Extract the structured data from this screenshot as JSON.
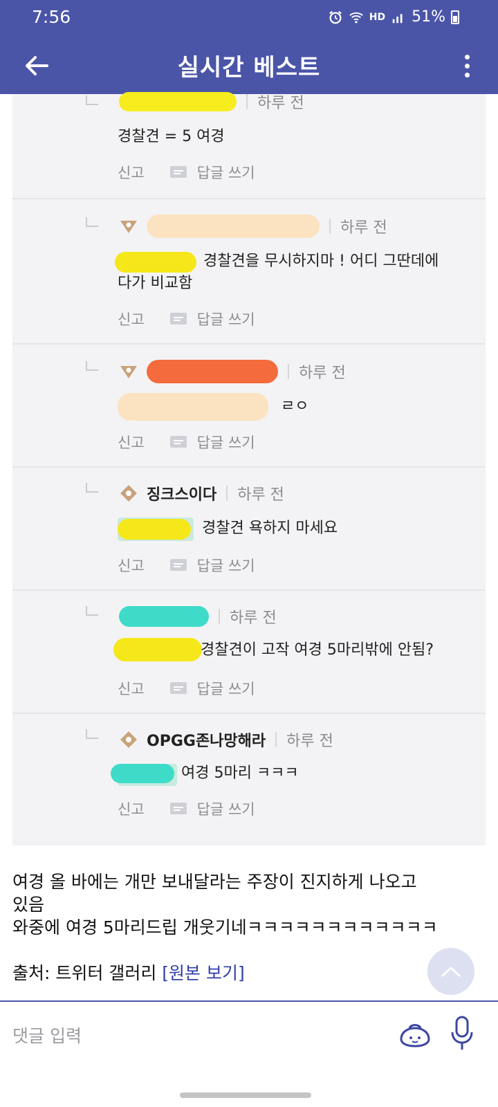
{
  "status_bar": {
    "time": "7:56",
    "network": "HD",
    "battery": "51%"
  },
  "header": {
    "title": "실시간 베스트"
  },
  "replies": [
    {
      "nickname": "",
      "time": "하루 전",
      "text": "경찰견 = 5 여경",
      "report": "신고",
      "reply_label": "답글 쓰기"
    },
    {
      "nickname": "",
      "time": "하루 전",
      "text_line1": "경찰견을 무시하지마 ! 어디 그딴데에",
      "text_line2": "다가 비교함",
      "report": "신고",
      "reply_label": "답글 쓰기"
    },
    {
      "nickname": "",
      "time": "하루 전",
      "text": "ㄹㅇ",
      "report": "신고",
      "reply_label": "답글 쓰기"
    },
    {
      "nickname": "징크스이다",
      "time": "하루 전",
      "text": "경찰견 욕하지 마세요",
      "report": "신고",
      "reply_label": "답글 쓰기"
    },
    {
      "nickname": "",
      "time": "하루 전",
      "text": "경찰견이 고작 여경 5마리밖에 안됨?",
      "report": "신고",
      "reply_label": "답글 쓰기"
    },
    {
      "nickname": "OPGG존나망해라",
      "time": "하루 전",
      "text": "여경 5마리 ㅋㅋㅋ",
      "report": "신고",
      "reply_label": "답글 쓰기"
    }
  ],
  "article": {
    "line1": "여경 올 바에는 개만 보내달라는 주장이 진지하게 나오고",
    "line2": "있음",
    "line3": "와중에 여경 5마리드립 개웃기네ㅋㅋㅋㅋㅋㅋㅋㅋㅋㅋㅋㅋ",
    "source_prefix": "출처: 트위터 갤러리 ",
    "source_link": "[원본 보기]"
  },
  "comment_input": {
    "placeholder": "댓글 입력"
  },
  "colors": {
    "accent": "#4b55a8",
    "link": "#2f3ea8"
  }
}
